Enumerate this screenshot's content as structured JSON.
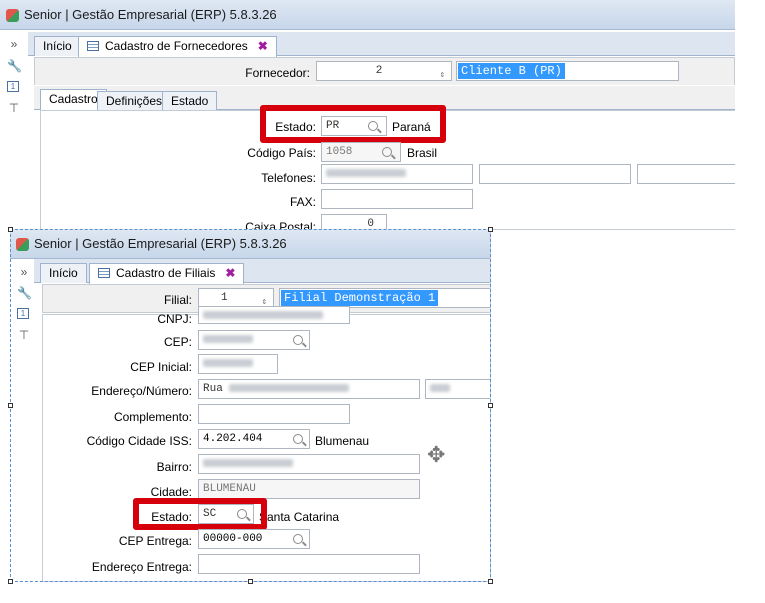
{
  "win1": {
    "title": "Senior | Gestão Empresarial (ERP) 5.8.3.26",
    "tab_home": "Início",
    "tab_form": "Cadastro de Fornecedores",
    "fornecedor_label": "Fornecedor:",
    "fornecedor_code": "2",
    "fornecedor_name": "Cliente B (PR)",
    "subtabs": [
      "Cadastro",
      "Definições",
      "Estado"
    ],
    "estado_label": "Estado:",
    "estado_value": "PR",
    "estado_name": "Paraná",
    "pais_label": "Código País:",
    "pais_value": "1058",
    "pais_name": "Brasil",
    "telefones_label": "Telefones:",
    "fax_label": "FAX:",
    "caixa_label": "Caixa Postal:",
    "caixa_value": "0"
  },
  "win2": {
    "title": "Senior | Gestão Empresarial (ERP) 5.8.3.26",
    "tab_home": "Início",
    "tab_form": "Cadastro de Filiais",
    "filial_label": "Filial:",
    "filial_code": "1",
    "filial_name": "Filial Demonstração 1",
    "cnpj_label": "CNPJ:",
    "cep_label": "CEP:",
    "cep_inicial_label": "CEP Inicial:",
    "endereco_label": "Endereço/Número:",
    "endereco_value": "Rua",
    "complemento_label": "Complemento:",
    "cidade_iss_label": "Código Cidade ISS:",
    "cidade_iss_value": "4.202.404",
    "cidade_iss_name": "Blumenau",
    "bairro_label": "Bairro:",
    "cidade_label": "Cidade:",
    "cidade_value": "BLUMENAU",
    "estado_label": "Estado:",
    "estado_value": "SC",
    "estado_name": "Santa Catarina",
    "cep_entrega_label": "CEP Entrega:",
    "cep_entrega_value": "00000-000",
    "endereco_entrega_label": "Endereço Entrega:"
  },
  "icons": [
    "chevrons-icon",
    "wrench-icon",
    "window-icon",
    "filter-icon",
    "magnifier-icon",
    "close-tab-icon",
    "move-icon"
  ],
  "colors": {
    "highlight": "#d6000d",
    "selection": "#3399ff"
  }
}
